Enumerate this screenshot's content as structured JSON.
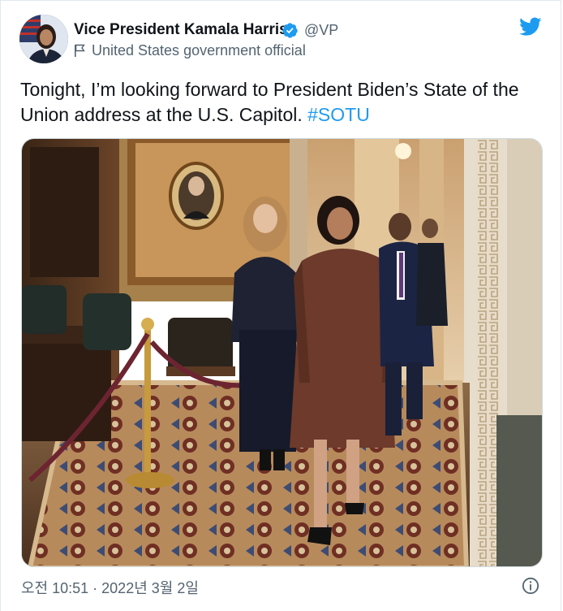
{
  "author": {
    "name": "Vice President Kamala Harris",
    "handle": "@VP",
    "label": "United States government official"
  },
  "icons": {
    "avatar": "profile-photo",
    "verified": "verified-badge-icon",
    "label": "government-flag-icon",
    "brand": "twitter-bird-icon",
    "info": "info-circle-icon"
  },
  "tweet": {
    "text": "Tonight, I’m looking forward to President Biden’s State of the Union address at the U.S. Capitol. ",
    "hashtag": "#SOTU"
  },
  "timestamp": "오전 10:51 · 2022년 3월 2일",
  "colors": {
    "link": "#1d9bf0",
    "verified": "#1d9bf0",
    "secondary_text": "#536471"
  }
}
